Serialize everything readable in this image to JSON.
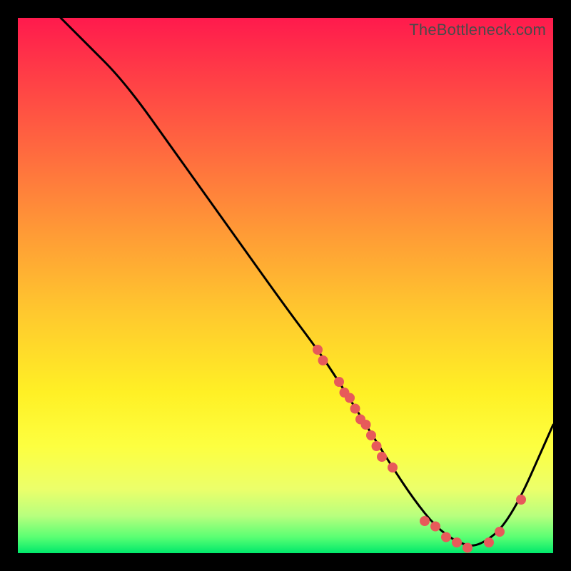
{
  "watermark": "TheBottleneck.com",
  "chart_data": {
    "type": "line",
    "title": "",
    "xlabel": "",
    "ylabel": "",
    "xlim": [
      0,
      100
    ],
    "ylim": [
      0,
      100
    ],
    "grid": false,
    "series": [
      {
        "name": "curve",
        "x": [
          8,
          12,
          20,
          30,
          40,
          50,
          56,
          60,
          65,
          70,
          74,
          78,
          82,
          86,
          92,
          100
        ],
        "values": [
          100,
          96,
          88,
          74,
          60,
          46,
          38,
          32,
          24,
          16,
          10,
          5,
          2,
          1,
          6,
          24
        ]
      }
    ],
    "scatter": [
      {
        "name": "dots",
        "color": "#e75a5a",
        "points": [
          {
            "x": 56,
            "y": 38
          },
          {
            "x": 57,
            "y": 36
          },
          {
            "x": 60,
            "y": 32
          },
          {
            "x": 61,
            "y": 30
          },
          {
            "x": 62,
            "y": 29
          },
          {
            "x": 63,
            "y": 27
          },
          {
            "x": 64,
            "y": 25
          },
          {
            "x": 65,
            "y": 24
          },
          {
            "x": 66,
            "y": 22
          },
          {
            "x": 67,
            "y": 20
          },
          {
            "x": 68,
            "y": 18
          },
          {
            "x": 70,
            "y": 16
          },
          {
            "x": 76,
            "y": 6
          },
          {
            "x": 78,
            "y": 5
          },
          {
            "x": 80,
            "y": 3
          },
          {
            "x": 82,
            "y": 2
          },
          {
            "x": 84,
            "y": 1
          },
          {
            "x": 88,
            "y": 2
          },
          {
            "x": 90,
            "y": 4
          },
          {
            "x": 94,
            "y": 10
          }
        ]
      }
    ]
  }
}
